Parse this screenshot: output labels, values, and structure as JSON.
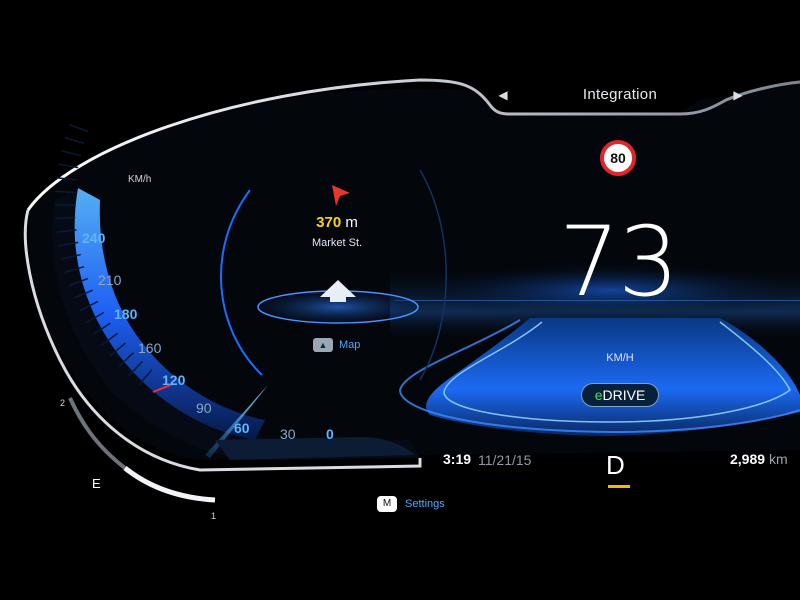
{
  "header": {
    "title": "Integration",
    "prev_icon": "◀",
    "next_icon": "▶"
  },
  "speed_limit": "80",
  "speed": {
    "value": "73",
    "unit": "KM/H"
  },
  "drive_mode": {
    "prefix": "e",
    "label": "DRIVE"
  },
  "speedometer": {
    "unit": "KM/h",
    "ticks": [
      {
        "label": "240",
        "major": true
      },
      {
        "label": "210",
        "major": false
      },
      {
        "label": "180",
        "major": true
      },
      {
        "label": "160",
        "major": false
      },
      {
        "label": "120",
        "major": true
      },
      {
        "label": "90",
        "major": false
      },
      {
        "label": "60",
        "major": true
      },
      {
        "label": "30",
        "major": false
      },
      {
        "label": "0",
        "major": true
      }
    ]
  },
  "navigation": {
    "distance": "370",
    "distance_unit": "m",
    "street": "Market St.",
    "map_key": "▲",
    "map_label": "Map"
  },
  "settings": {
    "key": "M",
    "label": "Settings"
  },
  "status": {
    "time": "3:19",
    "date": "11/21/15",
    "gear": "D",
    "odometer": "2,989",
    "odometer_unit": "km"
  },
  "fuel": {
    "empty_label": "E",
    "mark_upper": "2",
    "mark_lower": "1"
  },
  "colors": {
    "accent_blue": "#1e7bff",
    "limit_red": "#e0262b",
    "distance_yellow": "#ffd21a",
    "gear_underline": "#f5b800",
    "edrive_green": "#37e06a"
  }
}
